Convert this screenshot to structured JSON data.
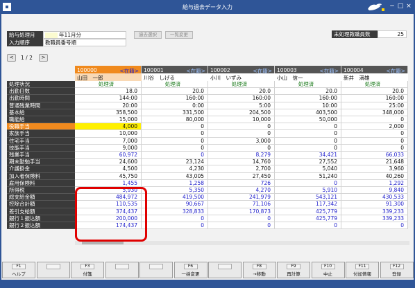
{
  "window": {
    "title": "給与過去データ入力",
    "minimize": "−",
    "maximize": "□",
    "close": "×"
  },
  "header": {
    "period_label": "給与処理月",
    "period_value": "年11月分",
    "sort_label": "入力順序",
    "sort_value": "教職員番号順",
    "btn_disabled1": "過去選択",
    "btn_disabled2": "一覧変更",
    "unprocessed_label": "未処理教職員数",
    "unprocessed_value": "25"
  },
  "pager": {
    "prev": "<",
    "text": "1 / 2",
    "next": ">"
  },
  "table": {
    "status_label": "処理状況",
    "employees": [
      {
        "code": "100000",
        "status": "<在籍>",
        "name": "山田　一郎",
        "highlight": true
      },
      {
        "code": "100001",
        "status": "<在籍>",
        "name": "川谷　しげる"
      },
      {
        "code": "100002",
        "status": "<在籍>",
        "name": "小川　いずみ"
      },
      {
        "code": "100003",
        "status": "<在籍>",
        "name": "小山　信一"
      },
      {
        "code": "100004",
        "status": "<在籍>",
        "name": "新井　満雄"
      }
    ],
    "rows": [
      {
        "label": "処理状況",
        "type": "status",
        "values": [
          "処理済",
          "処理済",
          "処理済",
          "処理済",
          "処理済"
        ]
      },
      {
        "label": "出勤日数",
        "values": [
          "18.0",
          "20.0",
          "20.0",
          "20.0",
          "20.0"
        ]
      },
      {
        "label": "出勤時間",
        "values": [
          "144:00",
          "160:00",
          "160:00",
          "160:00",
          "160:00"
        ]
      },
      {
        "label": "普通残業時間",
        "values": [
          "20:00",
          "0:00",
          "5:00",
          "10:00",
          "25:00"
        ]
      },
      {
        "label": "基本給",
        "values": [
          "358,500",
          "331,500",
          "204,500",
          "403,500",
          "348,000"
        ]
      },
      {
        "label": "職能給",
        "values": [
          "15,000",
          "80,000",
          "10,000",
          "50,000",
          "0"
        ]
      },
      {
        "label": "役職手当",
        "highlight": true,
        "values": [
          "4,000",
          "0",
          "0",
          "0",
          "2,000"
        ]
      },
      {
        "label": "家族手当",
        "values": [
          "10,000",
          "0",
          "0",
          "0",
          "0"
        ]
      },
      {
        "label": "住宅手当",
        "values": [
          "7,000",
          "0",
          "3,000",
          "0",
          "0"
        ]
      },
      {
        "label": "技能手当",
        "values": [
          "9,000",
          "0",
          "0",
          "0",
          "0"
        ]
      },
      {
        "label": "残業手当",
        "blue": true,
        "values": [
          "60,972",
          "0",
          "8,279",
          "34,421",
          "66,033"
        ]
      },
      {
        "label": "期末勤勉手当",
        "values": [
          "24,600",
          "23,124",
          "14,760",
          "27,552",
          "21,648"
        ]
      },
      {
        "label": "介護掛金",
        "values": [
          "4,500",
          "4,230",
          "2,700",
          "5,040",
          "3,960"
        ]
      },
      {
        "label": "加入者保険料",
        "values": [
          "45,750",
          "43,005",
          "27,450",
          "51,240",
          "40,260"
        ]
      },
      {
        "label": "雇用保険料",
        "blue": true,
        "values": [
          "1,455",
          "1,258",
          "726",
          "0",
          "1,292"
        ]
      },
      {
        "label": "所得税",
        "blue": true,
        "values": [
          "5,930",
          "5,350",
          "4,270",
          "5,910",
          "9,840"
        ]
      },
      {
        "label": "総支給金額",
        "blue": true,
        "values": [
          "484,972",
          "419,500",
          "241,979",
          "543,121",
          "430,533"
        ]
      },
      {
        "label": "控除合計額",
        "blue": true,
        "values": [
          "110,535",
          "90,667",
          "71,106",
          "117,342",
          "91,300"
        ]
      },
      {
        "label": "差引支給額",
        "blue": true,
        "values": [
          "374,437",
          "328,833",
          "170,873",
          "425,779",
          "339,233"
        ]
      },
      {
        "label": "銀行１振込額",
        "blue": true,
        "values": [
          "200,000",
          "0",
          "0",
          "425,779",
          "339,233"
        ]
      },
      {
        "label": "銀行２振込額",
        "blue": true,
        "values": [
          "174,437",
          "0",
          "0",
          "0",
          "0"
        ]
      }
    ]
  },
  "fkeys": [
    {
      "key": "F1",
      "label": "ヘルプ"
    },
    {
      "key": "",
      "label": ""
    },
    {
      "key": "F3",
      "label": "付箋"
    },
    {
      "key": "",
      "label": ""
    },
    {
      "key": "",
      "label": ""
    },
    {
      "key": "F6",
      "label": "一括変更"
    },
    {
      "key": "",
      "label": ""
    },
    {
      "key": "F8",
      "label": "→移動"
    },
    {
      "key": "F9",
      "label": "再計算"
    },
    {
      "key": "F10",
      "label": "中止"
    },
    {
      "key": "F11",
      "label": "付加情報"
    },
    {
      "key": "F12",
      "label": "登録"
    }
  ],
  "colors": {
    "accent": "#2f5597",
    "highlight_orange": "#f08a1e",
    "highlight_yellow": "#fff000",
    "status_blue": "#2222cc",
    "annotation_red": "#e00000"
  }
}
